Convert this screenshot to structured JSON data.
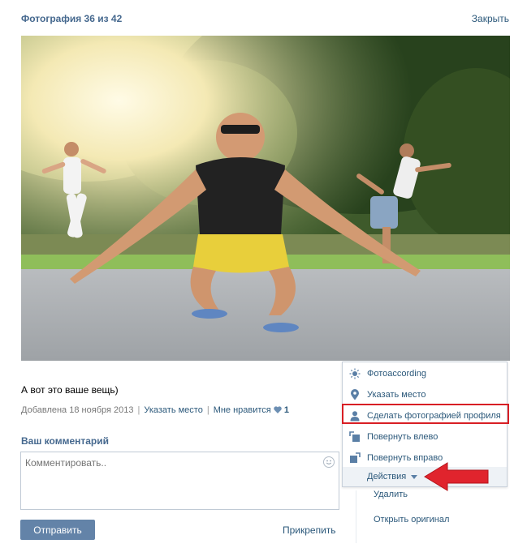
{
  "header": {
    "title": "Фотография 36 из 42",
    "close_label": "Закрыть"
  },
  "photo": {
    "alt_subject": ""
  },
  "caption": "А вот это ваше вещь)",
  "meta": {
    "added_prefix": "Добавлена",
    "added_date": "18 ноября 2013",
    "place_link": "Указать место",
    "like_link": "Мне нравится",
    "like_count": "1"
  },
  "comment": {
    "heading": "Ваш комментарий",
    "placeholder": "Комментировать..",
    "send_label": "Отправить",
    "attach_label": "Прикрепить"
  },
  "menu": {
    "items": [
      {
        "label": "Фотоaccording",
        "icon": "sun-icon"
      },
      {
        "label": "Указать место",
        "icon": "map-pin-icon"
      },
      {
        "label": "Сделать фотографией профиля",
        "icon": "person-icon"
      },
      {
        "label": "Повернуть влево",
        "icon": "rotate-left-icon"
      },
      {
        "label": "Повернуть вправо",
        "icon": "rotate-right-icon"
      }
    ],
    "actions_label": "Действия"
  },
  "below_menu": {
    "delete_label": "Удалить",
    "open_original_label": "Открыть оригинал"
  },
  "colors": {
    "link": "#2b587a",
    "heading": "#45688e",
    "button": "#6383a8",
    "highlight": "#d81e24",
    "arrow": "#e0242d"
  }
}
